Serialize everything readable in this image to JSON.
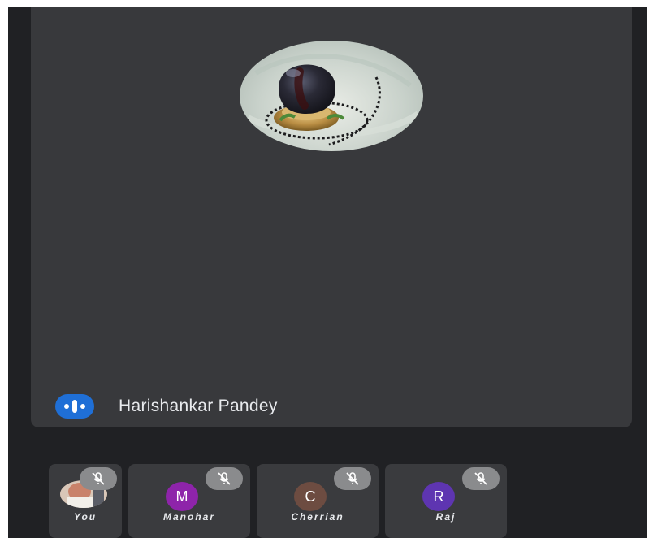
{
  "active_speaker": {
    "name": "Harishankar Pandey"
  },
  "participants": [
    {
      "name": "You",
      "avatar_letter": "",
      "avatar_color": "",
      "muted": true
    },
    {
      "name": "Manohar",
      "avatar_letter": "M",
      "avatar_color": "#8e24aa",
      "muted": true
    },
    {
      "name": "Cherrian",
      "avatar_letter": "C",
      "avatar_color": "#6d4c41",
      "muted": true
    },
    {
      "name": "Raj",
      "avatar_letter": "R",
      "avatar_color": "#5e35b1",
      "muted": true
    }
  ],
  "colors": {
    "speaking_indicator": "#1f6fd6",
    "background": "#202124",
    "tile": "#38393c"
  },
  "icons": {
    "speaking": "audio-level-icon",
    "muted": "mic-off-icon"
  }
}
